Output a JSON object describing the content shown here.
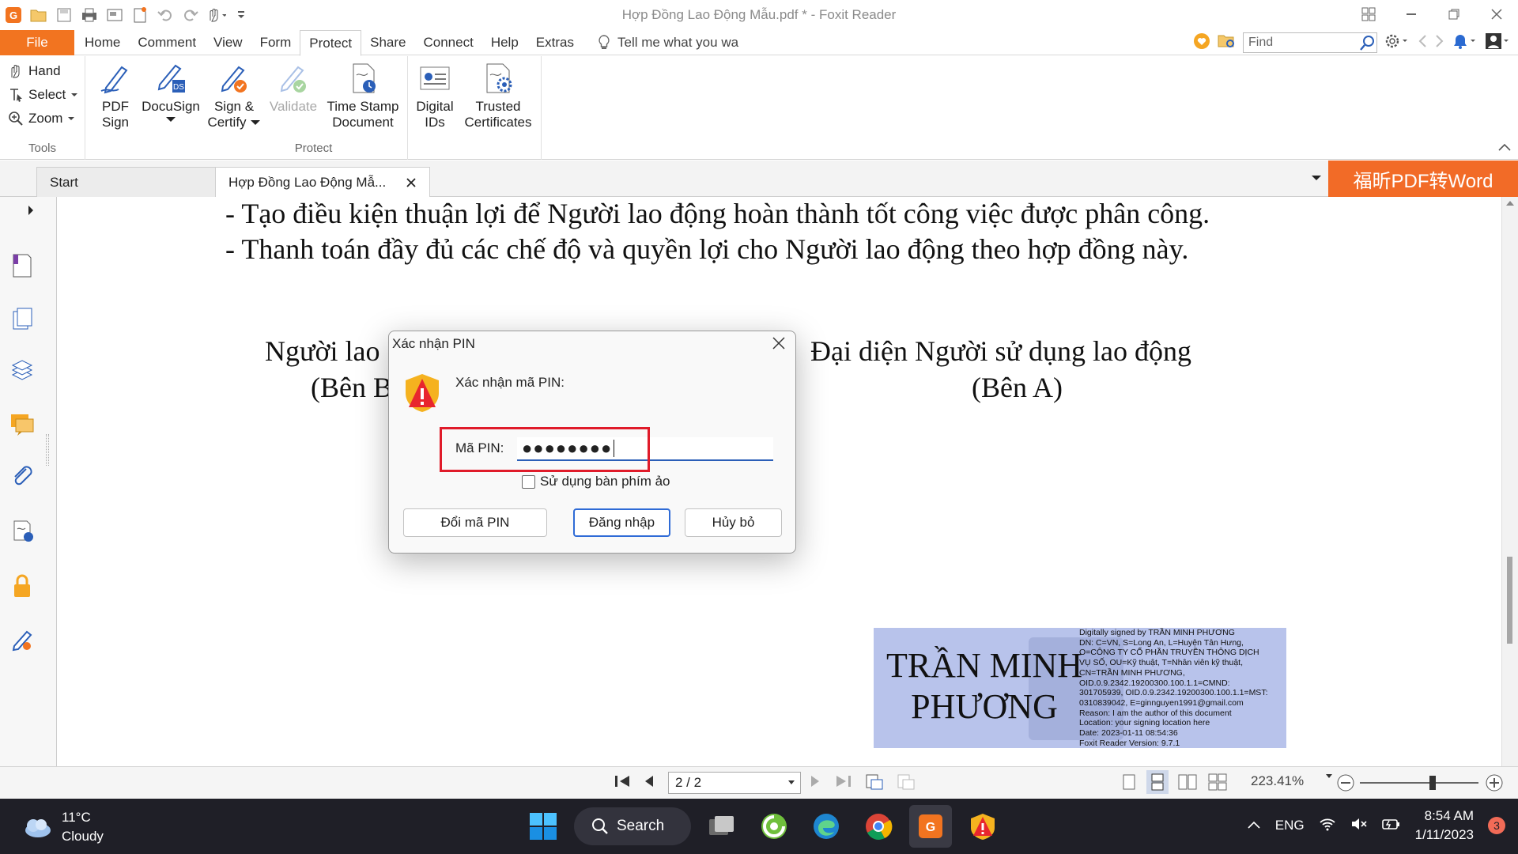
{
  "window": {
    "title": "Hợp Đồng Lao Động Mẫu.pdf * - Foxit Reader"
  },
  "menu": {
    "file": "File",
    "tabs": [
      "Home",
      "Comment",
      "View",
      "Form",
      "Protect",
      "Share",
      "Connect",
      "Help",
      "Extras"
    ],
    "active_tab": "Protect",
    "tell_me": "Tell me what you wa",
    "find_placeholder": "Find"
  },
  "ribbon": {
    "tools": {
      "hand": "Hand",
      "select": "Select",
      "zoom": "Zoom",
      "group_label": "Tools"
    },
    "protect": {
      "pdf_sign_l1": "PDF",
      "pdf_sign_l2": "Sign",
      "docusign": "DocuSign",
      "sign_certify_l1": "Sign &",
      "sign_certify_l2": "Certify",
      "validate": "Validate",
      "timestamp_l1": "Time Stamp",
      "timestamp_l2": "Document",
      "digital_ids_l1": "Digital",
      "digital_ids_l2": "IDs",
      "trusted_l1": "Trusted",
      "trusted_l2": "Certificates",
      "group_label": "Protect"
    }
  },
  "doc_tabs": {
    "start": "Start",
    "document": "Hợp Đồng Lao Động Mẫ...",
    "promo": "福昕PDF转Word"
  },
  "document": {
    "line1": "- Tạo điều kiện thuận lợi để Người lao động hoàn thành tốt công việc được phân công.",
    "line2": "- Thanh toán đầy đủ các chế độ và quyền lợi cho Người lao động theo hợp đồng này.",
    "left_heading_1": "Người lao",
    "left_heading_2": "(Bên B",
    "right_heading_1": "Đại diện Người sử dụng lao động",
    "right_heading_2": "(Bên A)",
    "signature": {
      "name_l1": "TRẦN MINH",
      "name_l2": "PHƯƠNG",
      "info": [
        "Digitally signed by TRẦN MINH PHƯƠNG",
        "DN: C=VN, S=Long An, L=Huyện Tân Hưng,",
        "O=CÔNG TY CỔ PHẦN TRUYỀN THÔNG DỊCH",
        "VỤ SỐ, OU=Kỹ thuật, T=Nhân viên kỹ thuật,",
        "CN=TRẦN MINH PHƯƠNG,",
        "OID.0.9.2342.19200300.100.1.1=CMND:",
        "301705939, OID.0.9.2342.19200300.100.1.1=MST:",
        "0310839042, E=ginnguyen1991@gmail.com",
        "Reason: I am the author of this document",
        "Location: your signing location here",
        "Date: 2023-01-11 08:54:36",
        "Foxit Reader Version: 9.7.1"
      ]
    }
  },
  "dialog": {
    "title": "Xác nhận PIN",
    "prompt": "Xác nhận mã PIN:",
    "pin_label": "Mã PIN:",
    "pin_value": "●●●●●●●●",
    "virtual_keyboard": "Sử dụng bàn phím ảo",
    "change_pin": "Đổi mã PIN",
    "login": "Đăng nhập",
    "cancel": "Hủy bỏ"
  },
  "statusbar": {
    "page": "2 / 2",
    "zoom": "223.41%"
  },
  "taskbar": {
    "temperature": "11°C",
    "weather": "Cloudy",
    "search": "Search",
    "language": "ENG",
    "time": "8:54 AM",
    "date": "1/11/2023",
    "notifications": "3"
  },
  "colors": {
    "accent": "#f27420",
    "promo": "#f26b27",
    "highlight": "#e01b2a",
    "signature_bg": "#b8c3eb",
    "taskbar": "#1f1f27"
  }
}
